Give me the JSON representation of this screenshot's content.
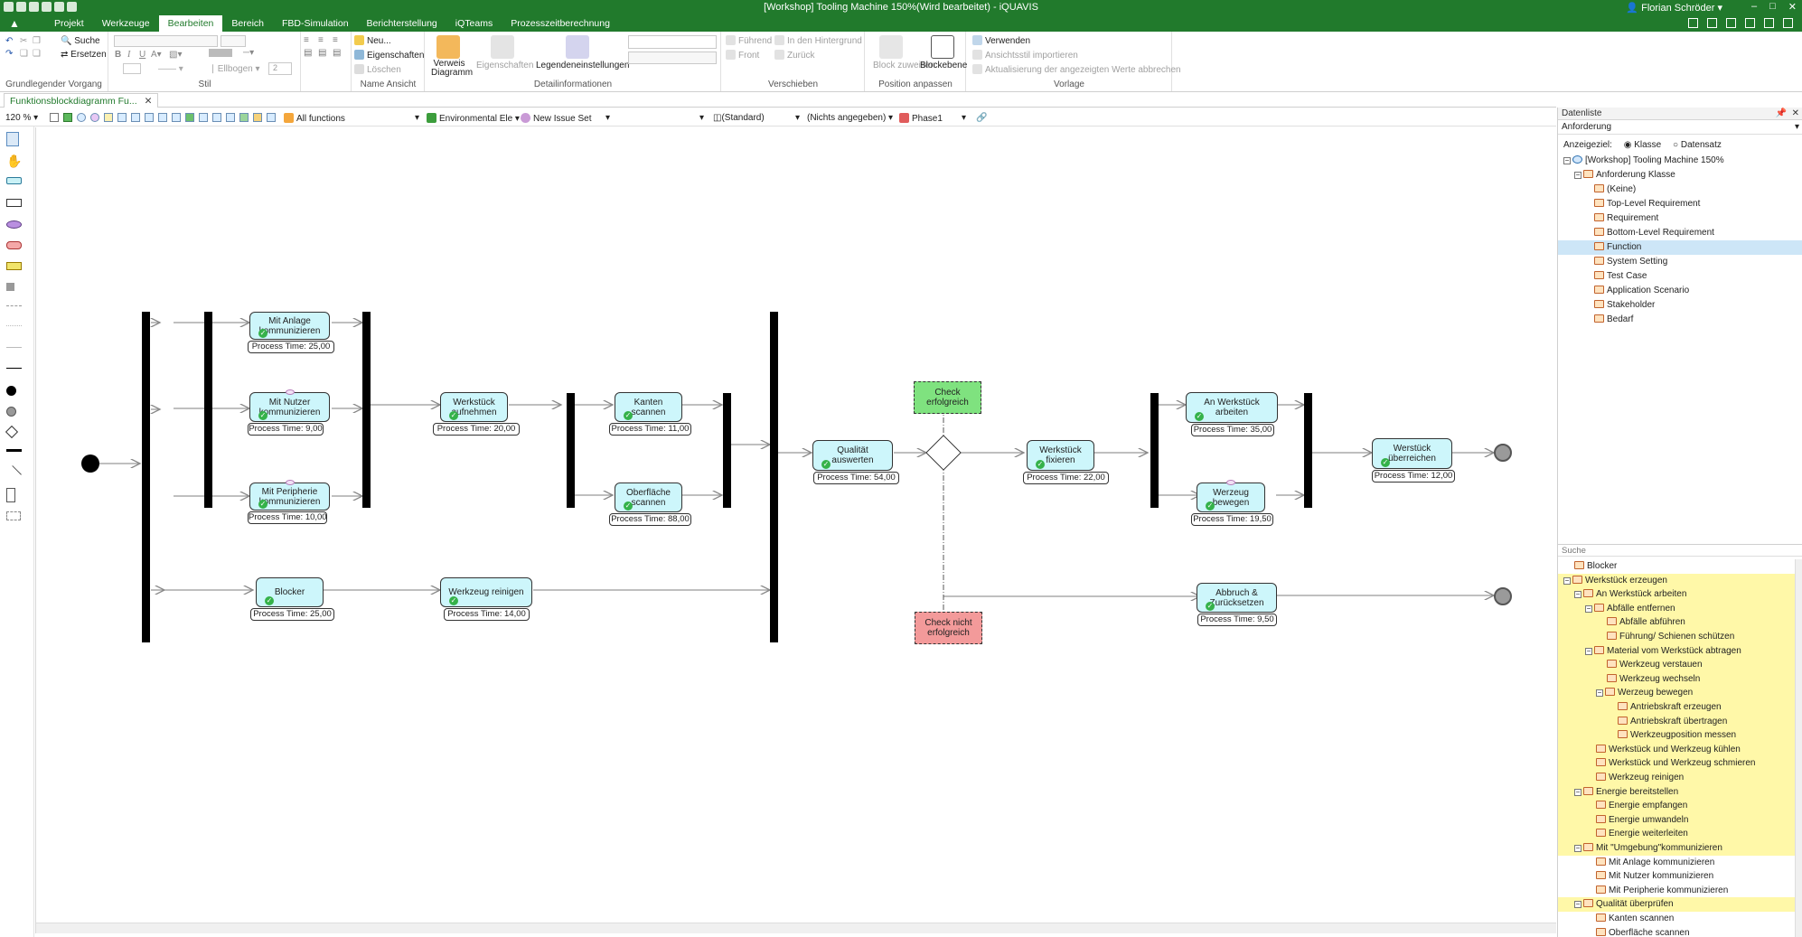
{
  "window": {
    "title": "[Workshop] Tooling Machine 150%(Wird bearbeitet) - iQUAVIS",
    "user": "Florian Schröder",
    "controls": [
      "–",
      "□",
      "✕"
    ]
  },
  "menu": {
    "tabs": [
      "Projekt",
      "Werkzeuge",
      "Bearbeiten",
      "Bereich",
      "FBD-Simulation",
      "Berichterstellung",
      "iQTeams",
      "Prozesszeitberechnung"
    ],
    "active": "Bearbeiten"
  },
  "ribbon": {
    "grundlegend": {
      "label": "Grundlegender Vorgang",
      "suche": "Suche",
      "ersetzen": "Ersetzen"
    },
    "stil": {
      "label": "Stil",
      "ellbogen": "Ellbogen",
      "spin_value": "2"
    },
    "name_ansicht": {
      "label": "Name Ansicht",
      "neu": "Neu...",
      "eigenschaften": "Eigenschaften",
      "loeschen": "Löschen"
    },
    "detail": {
      "label": "Detailinformationen",
      "verweis": "Verweis",
      "diagramm": "Diagramm",
      "eigenschaften": "Eigenschaften",
      "legende": "Legendeneinstellungen"
    },
    "verschieben": {
      "label": "Verschieben",
      "fuehrend": "Führend",
      "hintergrund": "In den Hintergrund",
      "front": "Front",
      "zurueck": "Zurück"
    },
    "position": {
      "label": "Position anpassen",
      "block_zuweisen": "Block zuweisen",
      "blockebene": "Blockebene"
    },
    "vorlage": {
      "label": "Vorlage",
      "verwenden": "Verwenden",
      "ansichtsstil": "Ansichtsstil importieren",
      "aktualisierung": "Aktualisierung der angezeigten Werte abbrechen"
    }
  },
  "document_tab": {
    "label": "Funktionsblockdiagramm Fu...",
    "close": "✕"
  },
  "diagram_toolbar": {
    "zoom": "120 %",
    "functions": "All functions",
    "environment": "Environmental Ele",
    "issue_set": "New Issue Set",
    "standard": "(Standard)",
    "nicht": "(Nichts angegeben)",
    "phase": "Phase1"
  },
  "diagram": {
    "nodes": [
      {
        "id": "anlage",
        "label": "Mit Anlage kommunizieren",
        "time": "Process Time: 25,00"
      },
      {
        "id": "nutzer",
        "label": "Mit Nutzer kommunizieren",
        "time": "Process Time: 9,00"
      },
      {
        "id": "peripherie",
        "label": "Mit Peripherie kommunizieren",
        "time": "Process Time: 10,00"
      },
      {
        "id": "werkstueck_aufnehmen",
        "label": "Werkstück aufnehmen",
        "time": "Process Time: 20,00"
      },
      {
        "id": "kanten",
        "label": "Kanten scannen",
        "time": "Process Time: 11,00"
      },
      {
        "id": "oberflaeche",
        "label": "Oberfläche scannen",
        "time": "Process Time: 88,00"
      },
      {
        "id": "qualitaet",
        "label": "Qualität auswerten",
        "time": "Process Time: 54,00"
      },
      {
        "id": "fixieren",
        "label": "Werkstück fixieren",
        "time": "Process Time: 22,00"
      },
      {
        "id": "an_werkstueck",
        "label": "An Werkstück arbeiten",
        "time": "Process Time: 35,00"
      },
      {
        "id": "werkzeug_bewegen",
        "label": "Werzeug bewegen",
        "time": "Process Time: 19,50"
      },
      {
        "id": "ueberreichen",
        "label": "Werstück überreichen",
        "time": "Process Time: 12,00"
      },
      {
        "id": "blocker",
        "label": "Blocker",
        "time": "Process Time: 25,00"
      },
      {
        "id": "reinigen",
        "label": "Werkzeug reinigen",
        "time": "Process Time: 14,00"
      },
      {
        "id": "abbruch",
        "label": "Abbruch & Zurücksetzen",
        "time": "Process Time: 9,50"
      }
    ],
    "notes": {
      "success": "Check erfolgreich",
      "failure": "Check nicht erfolgreich",
      "success_color": "#7fe27f",
      "failure_color": "#f39a9a"
    }
  },
  "right_panel": {
    "datalist_header": "Datenliste",
    "anforderung": "Anforderung",
    "anzeigeziel_label": "Anzeigeziel:",
    "option_klasse": "Klasse",
    "option_datensatz": "Datensatz",
    "tree_top": [
      {
        "label": "[Workshop] Tooling Machine 150%",
        "level": 0,
        "exp": "⊟"
      },
      {
        "label": "Anforderung Klasse",
        "level": 1,
        "exp": "⊟"
      },
      {
        "label": "(Keine)",
        "level": 2
      },
      {
        "label": "Top-Level Requirement",
        "level": 2
      },
      {
        "label": "Requirement",
        "level": 2
      },
      {
        "label": "Bottom-Level Requirement",
        "level": 2
      },
      {
        "label": "Function",
        "level": 2,
        "sel": true
      },
      {
        "label": "System Setting",
        "level": 2
      },
      {
        "label": "Test Case",
        "level": 2
      },
      {
        "label": "Application Scenario",
        "level": 2
      },
      {
        "label": "Stakeholder",
        "level": 2
      },
      {
        "label": "Bedarf",
        "level": 2
      }
    ],
    "search_label": "Suche",
    "tree_bottom": [
      {
        "label": "Blocker",
        "level": 0
      },
      {
        "label": "Werkstück erzeugen",
        "level": 0,
        "exp": "⊟",
        "hl": true
      },
      {
        "label": "An Werkstück arbeiten",
        "level": 1,
        "exp": "⊟",
        "hl": true
      },
      {
        "label": "Abfälle entfernen",
        "level": 2,
        "exp": "⊟",
        "hl": true
      },
      {
        "label": "Abfälle abführen",
        "level": 3,
        "hl": true
      },
      {
        "label": "Führung/ Schienen schützen",
        "level": 3,
        "hl": true
      },
      {
        "label": "Material vom Werkstück abtragen",
        "level": 2,
        "exp": "⊟",
        "hl": true
      },
      {
        "label": "Werkzeug verstauen",
        "level": 3,
        "hl": true
      },
      {
        "label": "Werkzeug wechseln",
        "level": 3,
        "hl": true
      },
      {
        "label": "Werzeug bewegen",
        "level": 3,
        "exp": "⊟",
        "hl": true
      },
      {
        "label": "Antriebskraft erzeugen",
        "level": 4,
        "hl": true
      },
      {
        "label": "Antriebskraft übertragen",
        "level": 4,
        "hl": true
      },
      {
        "label": "Werkzeugposition messen",
        "level": 4,
        "hl": true
      },
      {
        "label": "Werkstück und Werkzeug kühlen",
        "level": 2,
        "hl": true
      },
      {
        "label": "Werkstück und Werkzeug schmieren",
        "level": 2,
        "hl": true
      },
      {
        "label": "Werkzeug reinigen",
        "level": 2,
        "hl": true
      },
      {
        "label": "Energie bereitstellen",
        "level": 1,
        "exp": "⊟",
        "hl": true
      },
      {
        "label": "Energie empfangen",
        "level": 2,
        "hl": true
      },
      {
        "label": "Energie umwandeln",
        "level": 2,
        "hl": true
      },
      {
        "label": "Energie weiterleiten",
        "level": 2,
        "hl": true
      },
      {
        "label": "Mit \"Umgebung\"kommunizieren",
        "level": 1,
        "exp": "⊟",
        "hl": true
      },
      {
        "label": "Mit Anlage kommunizieren",
        "level": 2
      },
      {
        "label": "Mit Nutzer kommunizieren",
        "level": 2
      },
      {
        "label": "Mit Peripherie kommunizieren",
        "level": 2
      },
      {
        "label": "Qualität überprüfen",
        "level": 1,
        "exp": "⊟",
        "hl": true
      },
      {
        "label": "Kanten scannen",
        "level": 2
      },
      {
        "label": "Oberfläche scannen",
        "level": 2
      }
    ]
  },
  "colors": {
    "brand_green": "#217a2c",
    "node_fill": "#cdf6fb",
    "highlight": "#fff8a8",
    "selection": "#cde6f7"
  }
}
